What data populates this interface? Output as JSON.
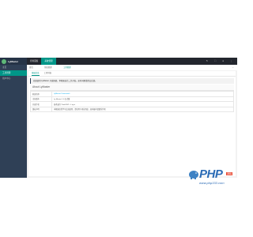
{
  "app": {
    "logo_text": "LyMaster"
  },
  "sidebar": {
    "items": [
      {
        "label": "主页"
      },
      {
        "label": "工具管理"
      },
      {
        "label": "用户中心"
      }
    ]
  },
  "header": {
    "menu": [
      {
        "label": "控制面板"
      },
      {
        "label": "系统管理"
      }
    ],
    "right_icons": [
      "refresh-icon",
      "fullscreen-icon",
      "user-icon",
      "menu-icon"
    ]
  },
  "tabs": {
    "items": [
      {
        "label": "首页"
      },
      {
        "label": "系统管理"
      },
      {
        "label": "工具管理"
      }
    ]
  },
  "card": {
    "tabs": [
      {
        "label": "基础信息"
      },
      {
        "label": "工具列表"
      }
    ],
    "notice": "欢迎使用 LyMaster 开发框架，本框架适合二次开发，如有问题请提交反馈。",
    "section_title": "About LyMaster",
    "rows": [
      {
        "key": "框架名称",
        "value": "LyMaster Framework",
        "link": true
      },
      {
        "key": "当前版本",
        "value": "Ly Master 1.0 正式版",
        "link": false
      },
      {
        "key": "开发作者",
        "value": "技术支持 ThinkPHP + Layui",
        "link": false
      },
      {
        "key": "版权声明",
        "value": "本框架仅供学习交流使用，请勿用于商业用途，如有疑问请联系作者",
        "link": false
      }
    ]
  },
  "watermark": {
    "text": "PHP",
    "badge": "源码",
    "url": "www.php333.com"
  },
  "colors": {
    "accent": "#009688",
    "sidebar": "#2f4056",
    "header": "#23262e"
  }
}
